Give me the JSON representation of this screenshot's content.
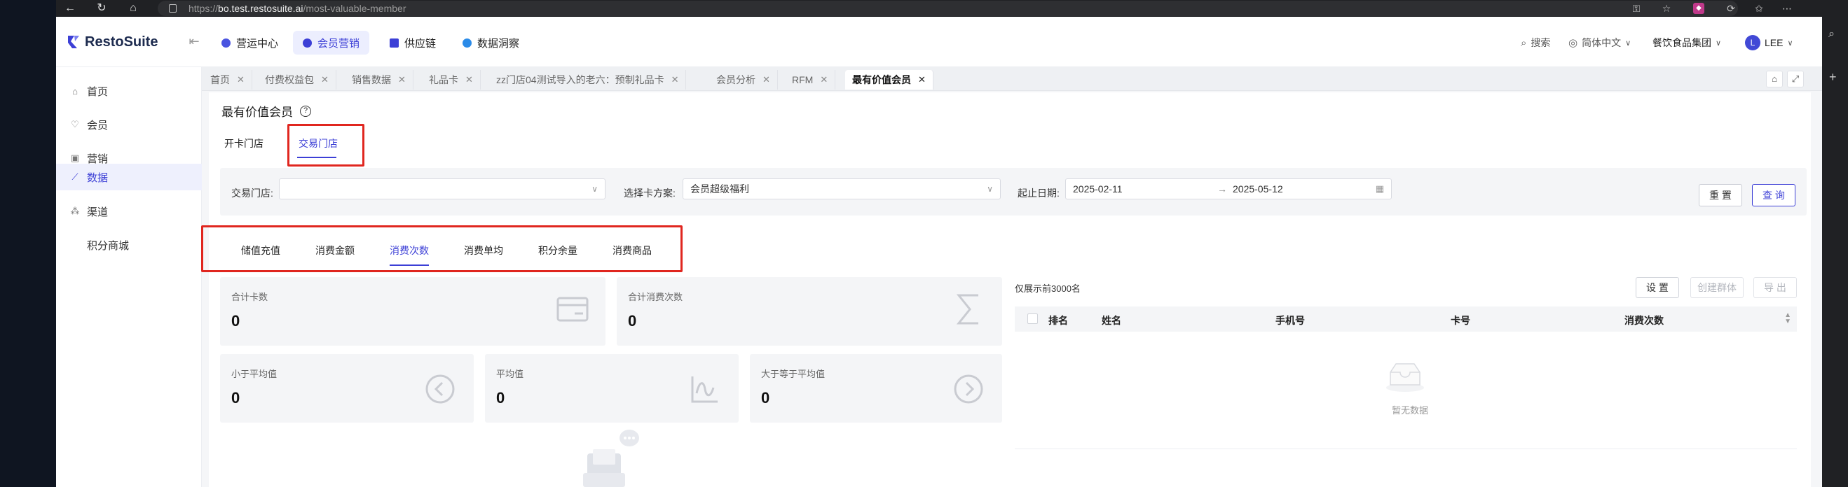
{
  "browser": {
    "url_prefix": "https://",
    "url_host": "bo.test.restosuite.ai",
    "url_path": "/most-valuable-member"
  },
  "app": {
    "brand": "RestoSuite",
    "modules": [
      {
        "label": "营运中心",
        "color": "#4a54e0"
      },
      {
        "label": "会员营销",
        "color": "#3c3fd6"
      },
      {
        "label": "供应链",
        "color": "#3c3fd6"
      },
      {
        "label": "数据洞察",
        "color": "#2b8be8"
      }
    ],
    "search_label": "搜索",
    "language": "简体中文",
    "org": "餐饮食品集团",
    "avatar_letter": "L",
    "user": "LEE"
  },
  "sidebar": {
    "items": [
      {
        "label": "首页",
        "icon": "home-icon"
      },
      {
        "label": "会员",
        "icon": "member-icon"
      },
      {
        "label": "营销",
        "icon": "gift-icon"
      },
      {
        "label": "数据",
        "icon": "chart-icon"
      },
      {
        "label": "渠道",
        "icon": "channel-icon"
      },
      {
        "label": "积分商城",
        "icon": ""
      }
    ]
  },
  "tabs": [
    {
      "label": "首页"
    },
    {
      "label": "付费权益包"
    },
    {
      "label": "销售数据"
    },
    {
      "label": "礼品卡"
    },
    {
      "label": "zz门店04测试导入的老六：预制礼品卡"
    },
    {
      "label": "会员分析"
    },
    {
      "label": "RFM"
    },
    {
      "label": "最有价值会员"
    }
  ],
  "page": {
    "title": "最有价值会员",
    "subtabs": [
      "开卡门店",
      "交易门店"
    ],
    "filters": {
      "store_label": "交易门店:",
      "store_value": "",
      "plan_label": "选择卡方案:",
      "plan_value": "会员超级福利",
      "date_label": "起止日期:",
      "date_start": "2025-02-11",
      "date_sep": "→",
      "date_end": "2025-05-12",
      "reset": "重 置",
      "query": "查 询"
    },
    "metric_tabs": [
      "储值充值",
      "消费金额",
      "消费次数",
      "消费单均",
      "积分余量",
      "消费商品"
    ],
    "cards": [
      {
        "label": "合计卡数",
        "value": "0"
      },
      {
        "label": "合计消费次数",
        "value": "0"
      },
      {
        "label": "小于平均值",
        "value": "0"
      },
      {
        "label": "平均值",
        "value": "0"
      },
      {
        "label": "大于等于平均值",
        "value": "0"
      }
    ],
    "table": {
      "note": "仅展示前3000名",
      "settings": "设 置",
      "create_group": "创建群体",
      "export": "导 出",
      "columns": [
        "排名",
        "姓名",
        "手机号",
        "卡号",
        "消费次数"
      ],
      "empty": "暂无数据"
    }
  }
}
